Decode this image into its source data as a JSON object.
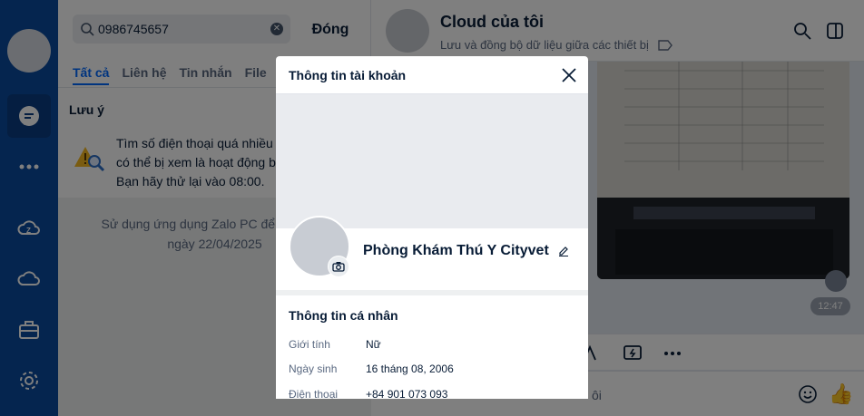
{
  "search": {
    "value": "0986745657",
    "close_label": "Đóng",
    "tabs": [
      "Tất cả",
      "Liên hệ",
      "Tin nhắn",
      "File"
    ],
    "note_title": "Lưu ý",
    "note_lines": [
      "Tìm số điện thoại quá nhiều lần",
      "có thể bị xem là hoạt động bất thường.",
      "Bạn hãy thử lại vào 08:00."
    ],
    "zalo_note_lines": [
      "Sử dụng ứng dụng Zalo PC để tìm thêm",
      "ngày 22/04/2025"
    ]
  },
  "chat": {
    "title": "Cloud của tôi",
    "subtitle": "Lưu và đồng bộ dữ liệu giữa các thiết bị",
    "time": "12:47",
    "composer_placeholder": "ôi"
  },
  "modal": {
    "title": "Thông tin tài khoản",
    "name": "Phòng Khám Thú Y Cityvet",
    "section_title": "Thông tin cá nhân",
    "rows": [
      {
        "label": "Giới tính",
        "value": "Nữ"
      },
      {
        "label": "Ngày sinh",
        "value": "16 tháng 08, 2006"
      },
      {
        "label": "Điện thoại",
        "value": "+84 901 073 093"
      }
    ]
  },
  "colors": {
    "rail": "#0b4a9e",
    "accent": "#0068ff",
    "overlay": "rgba(0,0,0,0.5)"
  }
}
